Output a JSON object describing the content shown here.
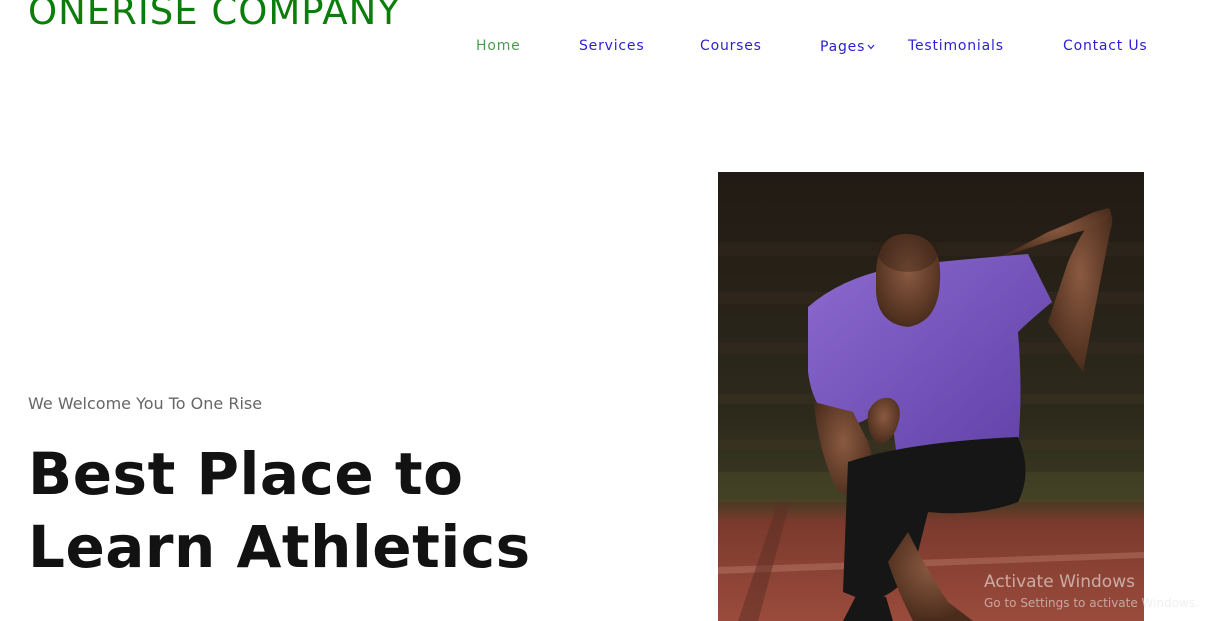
{
  "brand": {
    "name": "ONERISE COMPANY",
    "color": "#0b7d0b"
  },
  "nav": {
    "items": [
      {
        "label": "Home",
        "active": true
      },
      {
        "label": "Services"
      },
      {
        "label": "Courses"
      },
      {
        "label": "Pages",
        "has_dropdown": true,
        "icon": "chevron-down-icon"
      },
      {
        "label": "Testimonials"
      },
      {
        "label": "Contact Us"
      }
    ],
    "link_color": "#2b1fd6",
    "active_color": "#4f9a4f"
  },
  "hero": {
    "subtitle": "We Welcome You To One Rise",
    "title_line1": "Best Place to",
    "title_line2": "Learn Athletics",
    "image": "athlete-sprinting-photo"
  },
  "watermark": {
    "title": "Activate Windows",
    "subtitle": "Go to Settings to activate Windows."
  }
}
